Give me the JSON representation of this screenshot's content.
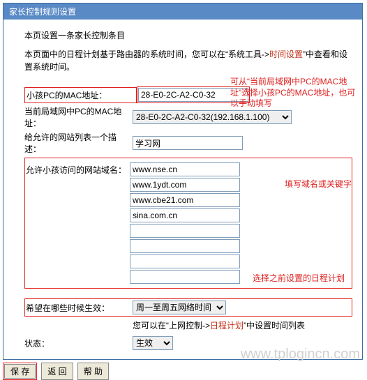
{
  "header": {
    "title": "家长控制规则设置"
  },
  "intro": {
    "line1": "本页设置一条家长控制条目",
    "line2_a": "本页面中的日程计划基于路由器的系统时间，您可以在“系统工具->",
    "time_link": "时间设置",
    "line2_b": "”中查看和设置系统时间。"
  },
  "fields": {
    "child_mac_label": "小孩PC的MAC地址：",
    "child_mac_value": "28-E0-2C-A2-C0-32",
    "lan_mac_label": "当前局域网中PC的MAC地址：",
    "lan_mac_value": "28-E0-2C-A2-C0-32(192.168.1.100)",
    "desc_label": "给允许的网站列表一个描述：",
    "desc_value": "学习网",
    "domains_label": "允许小孩访问的网站域名：",
    "domains": [
      "www.nse.cn",
      "www.1ydt.com",
      "www.cbe21.com",
      "sina.com.cn",
      "",
      "",
      "",
      ""
    ],
    "sched_label": "希望在哪些时候生效：",
    "sched_value": "周一至周五网络时间",
    "hint_a": "您可以在“上网控制->",
    "sched_link": "日程计划",
    "hint_b": "”中设置时间列表",
    "status_label": "状态：",
    "status_value": "生效"
  },
  "buttons": {
    "save": "保 存",
    "back": "返 回",
    "help": "帮 助"
  },
  "annotations": {
    "top": "可从“当前局域网中PC的MAC地址”选择小孩PC的MAC地址，也可以手动填写",
    "mid": "填写域名或关键字",
    "bot": "选择之前设置的日程计划"
  },
  "watermark": "www.tplogincn.com"
}
